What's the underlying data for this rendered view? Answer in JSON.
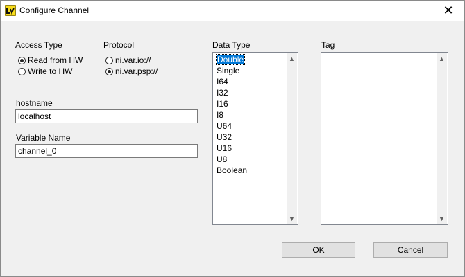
{
  "window": {
    "title": "Configure Channel"
  },
  "access_type": {
    "label": "Access Type",
    "options": [
      {
        "label": "Read from HW",
        "checked": true
      },
      {
        "label": "Write to HW",
        "checked": false
      }
    ]
  },
  "protocol": {
    "label": "Protocol",
    "options": [
      {
        "label": "ni.var.io://",
        "checked": false
      },
      {
        "label": "ni.var.psp://",
        "checked": true
      }
    ]
  },
  "hostname": {
    "label": "hostname",
    "value": "localhost"
  },
  "variable_name": {
    "label": "Variable Name",
    "value": "channel_0"
  },
  "data_type": {
    "label": "Data Type",
    "items": [
      "Double",
      "Single",
      "I64",
      "I32",
      "I16",
      "I8",
      "U64",
      "U32",
      "U16",
      "U8",
      "Boolean"
    ],
    "selected": "Double"
  },
  "tag": {
    "label": "Tag",
    "items": []
  },
  "buttons": {
    "ok": "OK",
    "cancel": "Cancel"
  }
}
